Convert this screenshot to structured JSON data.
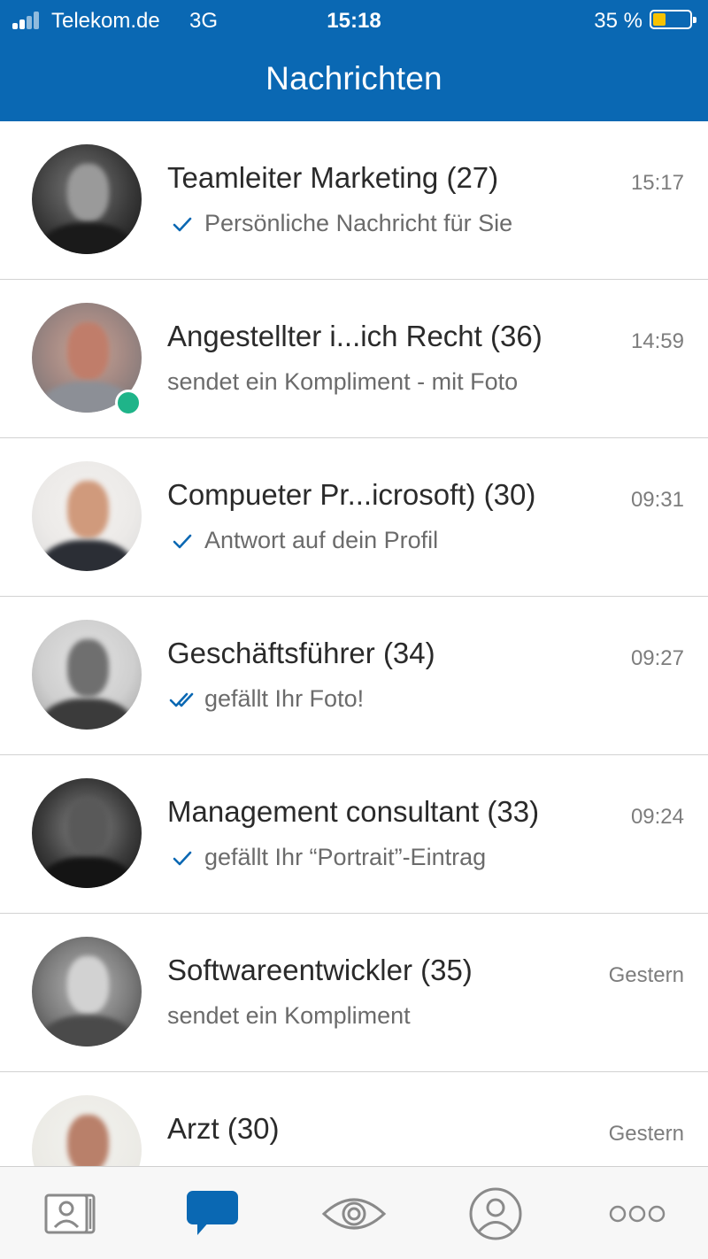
{
  "status_bar": {
    "carrier": "Telekom.de",
    "network": "3G",
    "time": "15:18",
    "battery_percent": "35 %",
    "battery_level": 0.35,
    "battery_color": "#f7c200"
  },
  "header": {
    "title": "Nachrichten",
    "background_color": "#0a68b3"
  },
  "conversations": [
    {
      "name": "Teamleiter Marketing (27)",
      "time": "15:17",
      "preview": "Persönliche Nachricht für Sie",
      "status_icon": "check-icon",
      "online": false
    },
    {
      "name": "Angestellter i...ich Recht (36)",
      "time": "14:59",
      "preview": "sendet ein Kompliment - mit Foto",
      "status_icon": "none",
      "online": true
    },
    {
      "name": "Compueter Pr...icrosoft) (30)",
      "time": "09:31",
      "preview": "Antwort auf dein Profil",
      "status_icon": "check-icon",
      "online": false
    },
    {
      "name": "Geschäftsführer  (34)",
      "time": "09:27",
      "preview": "gefällt Ihr Foto!",
      "status_icon": "double-check-icon",
      "online": false
    },
    {
      "name": "Management consultant (33)",
      "time": "09:24",
      "preview": "gefällt Ihr “Portrait”-Eintrag",
      "status_icon": "check-icon",
      "online": false
    },
    {
      "name": "Softwareentwickler (35)",
      "time": "Gestern",
      "preview": "sendet ein Kompliment",
      "status_icon": "none",
      "online": false
    },
    {
      "name": "Arzt (30)",
      "time": "Gestern",
      "preview": "",
      "status_icon": "none",
      "online": false
    }
  ],
  "tabbar": {
    "tabs": [
      {
        "icon": "contacts-icon",
        "active": false
      },
      {
        "icon": "chat-bubble-icon",
        "active": true
      },
      {
        "icon": "eye-icon",
        "active": false
      },
      {
        "icon": "profile-icon",
        "active": false
      },
      {
        "icon": "more-icon",
        "active": false
      }
    ],
    "active_color": "#0a68b3",
    "inactive_color": "#8a8a8a"
  }
}
